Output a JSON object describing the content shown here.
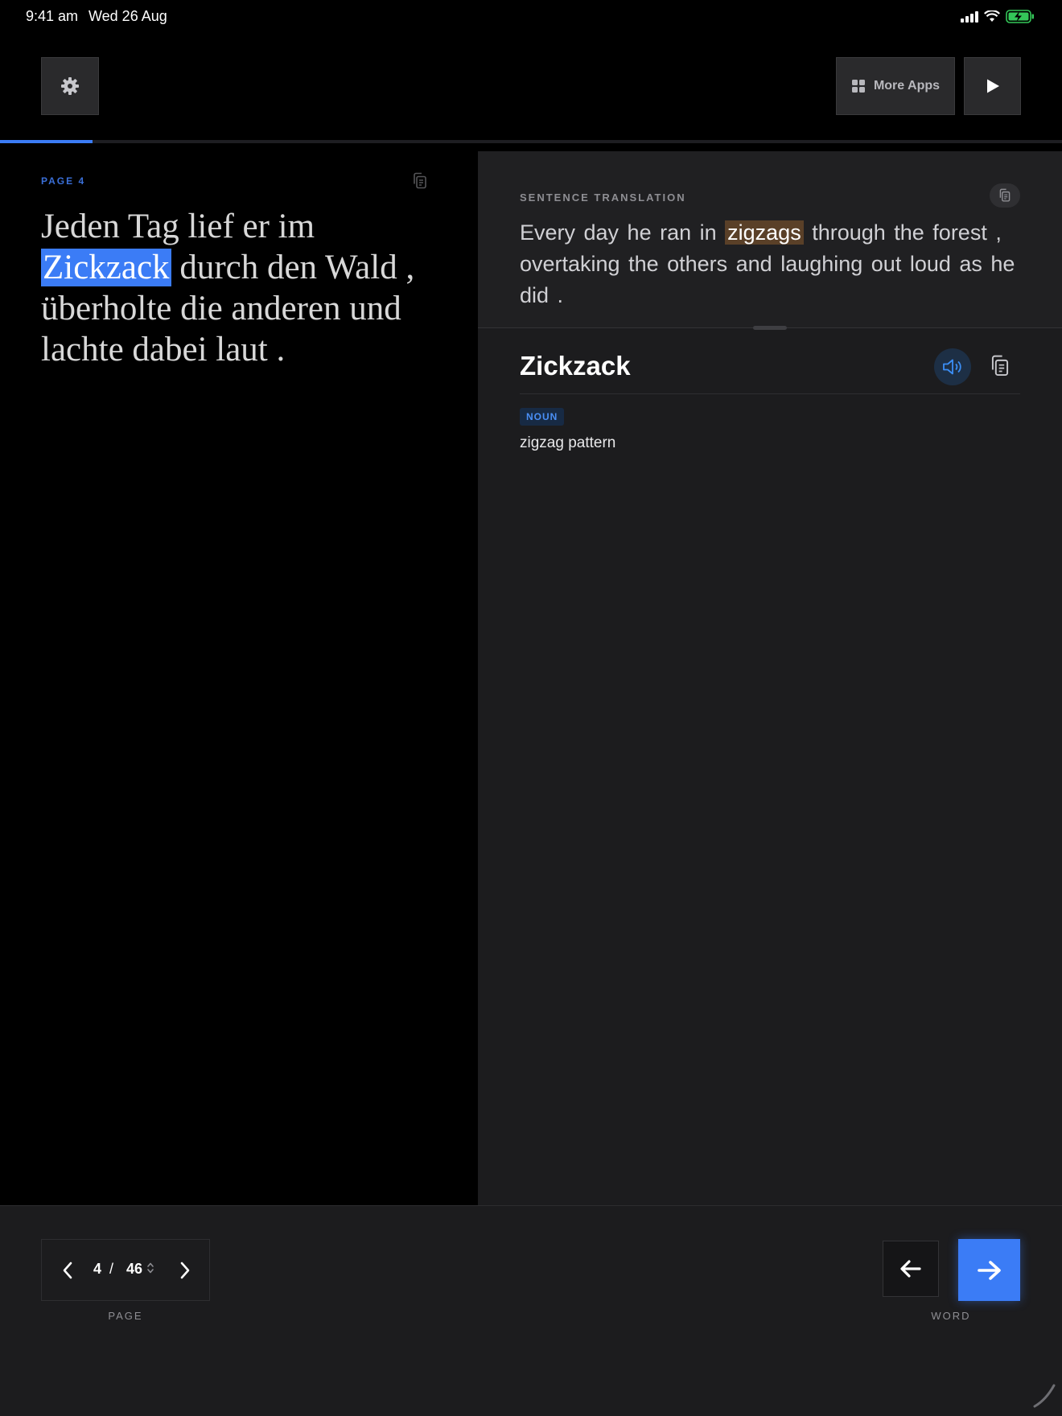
{
  "status_bar": {
    "time": "9:41 am",
    "date": "Wed 26 Aug",
    "icons": [
      "signal-icon",
      "wifi-icon",
      "battery-charging-icon"
    ],
    "battery_color": "#34c759"
  },
  "toolbar": {
    "settings_icon": "gear-icon",
    "more_apps_label": "More Apps",
    "more_apps_icon": "grid-icon",
    "play_icon": "play-icon"
  },
  "progress": {
    "value": 0.0869,
    "color": "#3b7cf6"
  },
  "source": {
    "page_label": "PAGE 4",
    "text_before": "Jeden Tag lief er im ",
    "highlighted_word": "Zickzack",
    "text_after": " durch den Wald , überholte die anderen und  lachte dabei laut ."
  },
  "translation": {
    "label": "SENTENCE TRANSLATION",
    "text_before": "Every day he ran in ",
    "highlighted_word": "zigzags",
    "text_after": " through the forest ,  overtaking the others and laughing out loud as  he did ."
  },
  "word": {
    "title": "Zickzack",
    "part_of_speech": "NOUN",
    "definition": "zigzag pattern"
  },
  "pager": {
    "current": "4",
    "separator": "/",
    "total": "46",
    "caption": "PAGE"
  },
  "word_nav": {
    "caption": "WORD",
    "accent": "#3b7cf6"
  }
}
